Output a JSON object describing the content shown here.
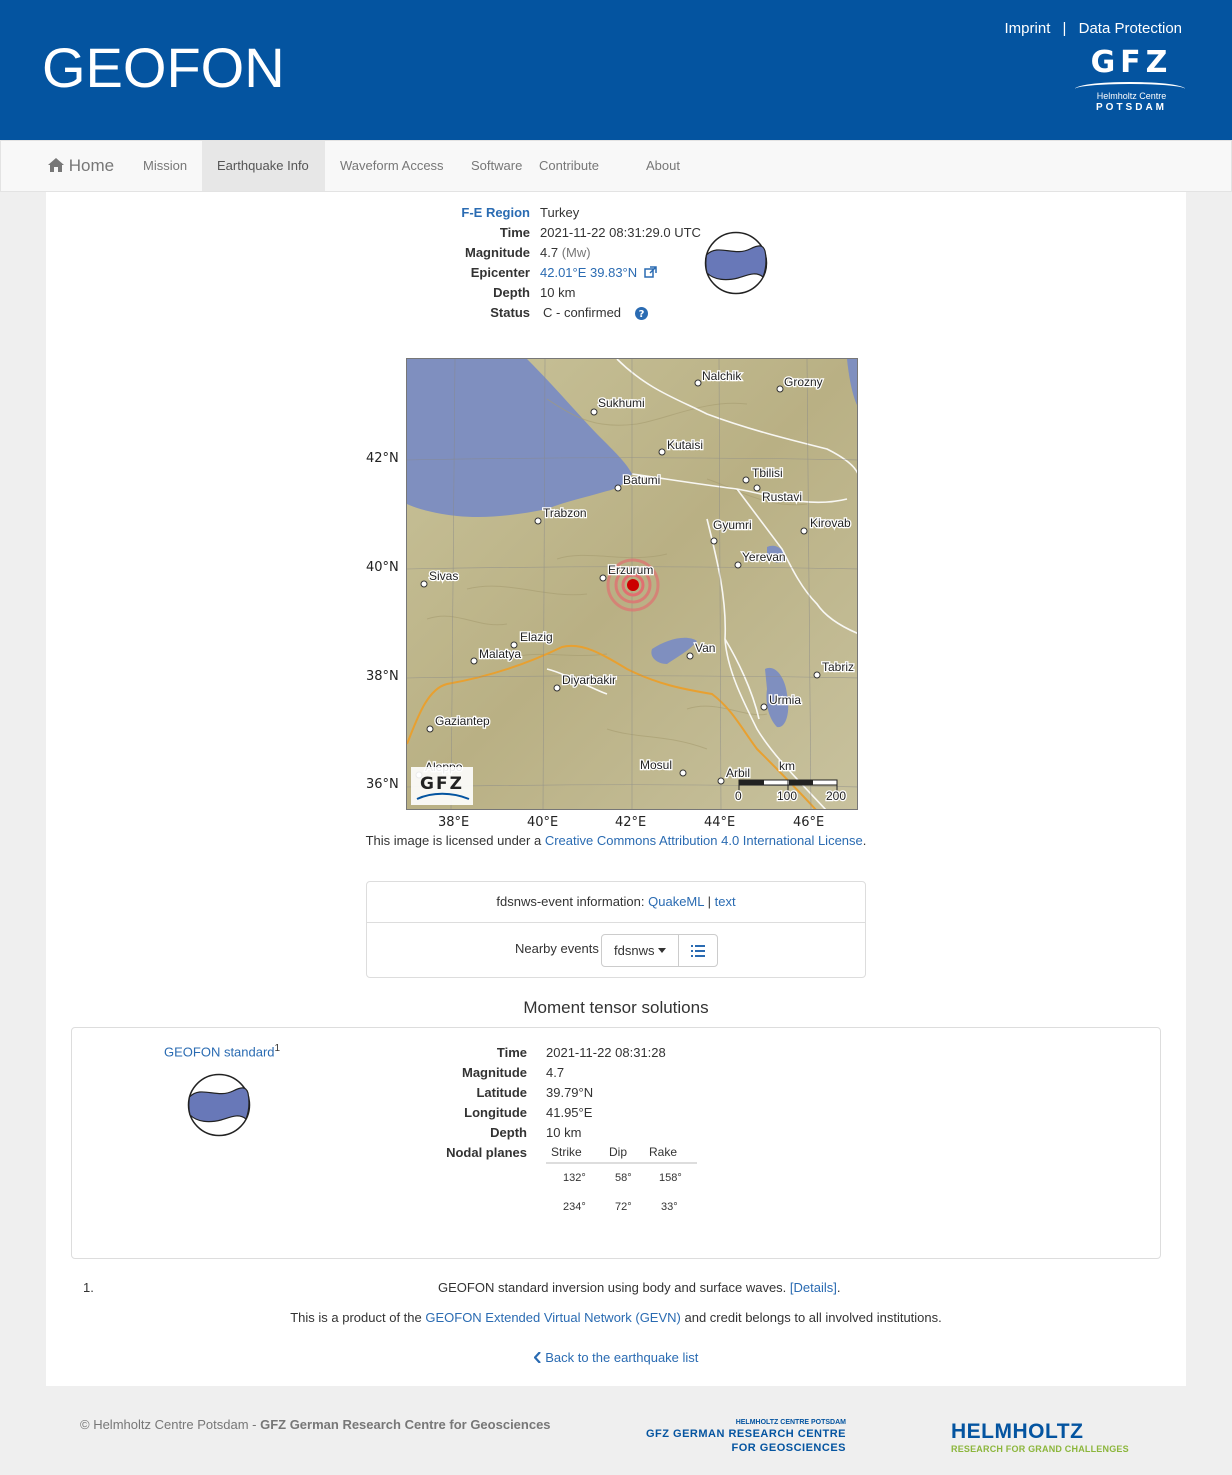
{
  "header": {
    "site_title": "GEOFON",
    "links": [
      "Imprint",
      "Data Protection"
    ],
    "separator": "|",
    "logo": {
      "letters": "GFZ",
      "line1": "Helmholtz Centre",
      "line2": "POTSDAM"
    }
  },
  "nav": {
    "home": "Home",
    "items": [
      "Mission",
      "Earthquake Info",
      "Waveform Access",
      "Software",
      "Contribute",
      "About"
    ],
    "active": "Earthquake Info"
  },
  "event": {
    "rows": [
      {
        "label": "F-E Region",
        "value": "Turkey"
      },
      {
        "label": "Time",
        "value": "2021-11-22 08:31:29.0 UTC"
      },
      {
        "label": "Magnitude",
        "value": "4.7",
        "extra": "(Mw)"
      },
      {
        "label": "Epicenter",
        "value": "42.01°E 39.83°N"
      },
      {
        "label": "Depth",
        "value": "10 km"
      },
      {
        "label": "Status",
        "value": "C",
        "extra": "- confirmed"
      }
    ]
  },
  "map": {
    "lat_labels": [
      "42°N",
      "40°N",
      "38°N",
      "36°N"
    ],
    "lon_labels": [
      "38°E",
      "40°E",
      "42°E",
      "44°E",
      "46°E"
    ],
    "cities": [
      "Nalchik",
      "Grozny",
      "Sukhumi",
      "Kutaisi",
      "Batumi",
      "Tbilisi",
      "Rustavi",
      "Trabzon",
      "Gyumri",
      "Kirovab",
      "Yerevan",
      "Erzurum",
      "Sivas",
      "Elazig",
      "Malatya",
      "Van",
      "Tabriz",
      "Diyarbakir",
      "Urmia",
      "Gaziantep",
      "Aleppo",
      "Mosul",
      "Arbil"
    ],
    "scale_unit": "km",
    "scale_labels": [
      "0",
      "100",
      "200"
    ],
    "logo": "GFZ"
  },
  "license": {
    "prefix": "This image is licensed under a ",
    "link": "Creative Commons Attribution 4.0 International License",
    "suffix": "."
  },
  "fdsn": {
    "label": "fdsnws-event information:",
    "links": [
      "QuakeML",
      "text"
    ],
    "sep": "|",
    "nearby_label": "Nearby events",
    "dropdown": "fdsnws"
  },
  "mt": {
    "title": "Moment tensor solutions",
    "solution_name": "GEOFON standard",
    "footnote_mark": "1",
    "rows": [
      {
        "label": "Time",
        "value": "2021-11-22 08:31:28"
      },
      {
        "label": "Magnitude",
        "value": "4.7"
      },
      {
        "label": "Latitude",
        "value": "39.79°N"
      },
      {
        "label": "Longitude",
        "value": "41.95°E"
      },
      {
        "label": "Depth",
        "value": "10 km"
      },
      {
        "label": "Nodal planes",
        "value": ""
      }
    ],
    "np_headers": [
      "Strike",
      "Dip",
      "Rake"
    ],
    "np_rows": [
      [
        "132°",
        "58°",
        "158°"
      ],
      [
        "234°",
        "72°",
        "33°"
      ]
    ]
  },
  "notes": {
    "num": "1.",
    "text": "GEOFON standard inversion using body and surface waves.",
    "details": "[Details]",
    "dot": ".",
    "credit_prefix": "This is a product of the ",
    "credit_link": "GEOFON Extended Virtual Network (GEVN)",
    "credit_suffix": " and credit belongs to all involved institutions.",
    "back": "Back to the earthquake list"
  },
  "footer": {
    "copyright_prefix": "© Helmholtz Centre Potsdam - ",
    "copyright_bold": "GFZ German Research Centre for Geosciences",
    "gfz_small": "HELMHOLTZ CENTRE POTSDAM",
    "gfz_line1": "GFZ GERMAN RESEARCH CENTRE",
    "gfz_line2": "FOR GEOSCIENCES",
    "helmholtz": "HELMHOLTZ",
    "helmholtz_tag": "RESEARCH FOR GRAND CHALLENGES"
  },
  "colors": {
    "brand": "#0454a0",
    "link": "#2a6bb2",
    "beachball": "#6878b8"
  }
}
